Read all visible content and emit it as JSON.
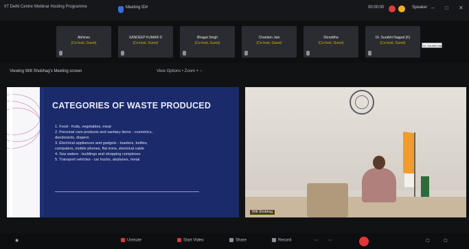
{
  "window": {
    "app_title": "IIT Delhi Centre Webinar Hosting Programme",
    "meeting_info": "Meeting ID#",
    "timer": "00:00:00",
    "view_label": "Speaker",
    "minimize_glyph": "–",
    "maximize_glyph": "□",
    "close_glyph": "✕"
  },
  "participants": [
    {
      "name": "Abhinav",
      "status": "(Co-host, Guest)"
    },
    {
      "name": "SANDEEP KUMAR D",
      "status": "(Co-host, Guest)"
    },
    {
      "name": "Bhagat Singh",
      "status": "(Co-host, Guest)"
    },
    {
      "name": "Chandan Jain",
      "status": "(Co-host, Guest)"
    },
    {
      "name": "Shraddha",
      "status": "(Co-host, Guest)"
    },
    {
      "name": "Dr. Surabhi Nagpal (K)",
      "status": "(Co-host, Guest)"
    }
  ],
  "hover_tooltip": "Dr. Surabhi Nagpal",
  "share_bar": {
    "viewing": "Viewing Witt Shobhag's Meeting screen",
    "view_options": "View Options  •  Zoom  +  −"
  },
  "slide": {
    "title": "CATEGORIES OF WASTE PRODUCED",
    "items": [
      "1. Food - fruits, vegetables, meat",
      "2. Personal care products and sanitary items - cosmetics,",
      "   deodorants, diapers",
      "3. Electrical appliances and gadgets - toasters, kettles,",
      "   computers, mobile phones, flat irons, electrical cable",
      "4. Sea waters - buildings and shopping complexes",
      "5. Transport vehicles - car trucks, airplanes, metal"
    ]
  },
  "video": {
    "name_tag": "Witt Shobhag"
  },
  "toolbar": {
    "unmute": "Unmute",
    "start_video": "Start Video",
    "share": "Share",
    "record": "Record",
    "more_1": "⋯",
    "more_2": "⋯"
  },
  "colors": {
    "slide_bg": "#1b2a6b",
    "end_button": "#e43636",
    "recording": "#e23b3b",
    "status_text": "#d4b100"
  }
}
